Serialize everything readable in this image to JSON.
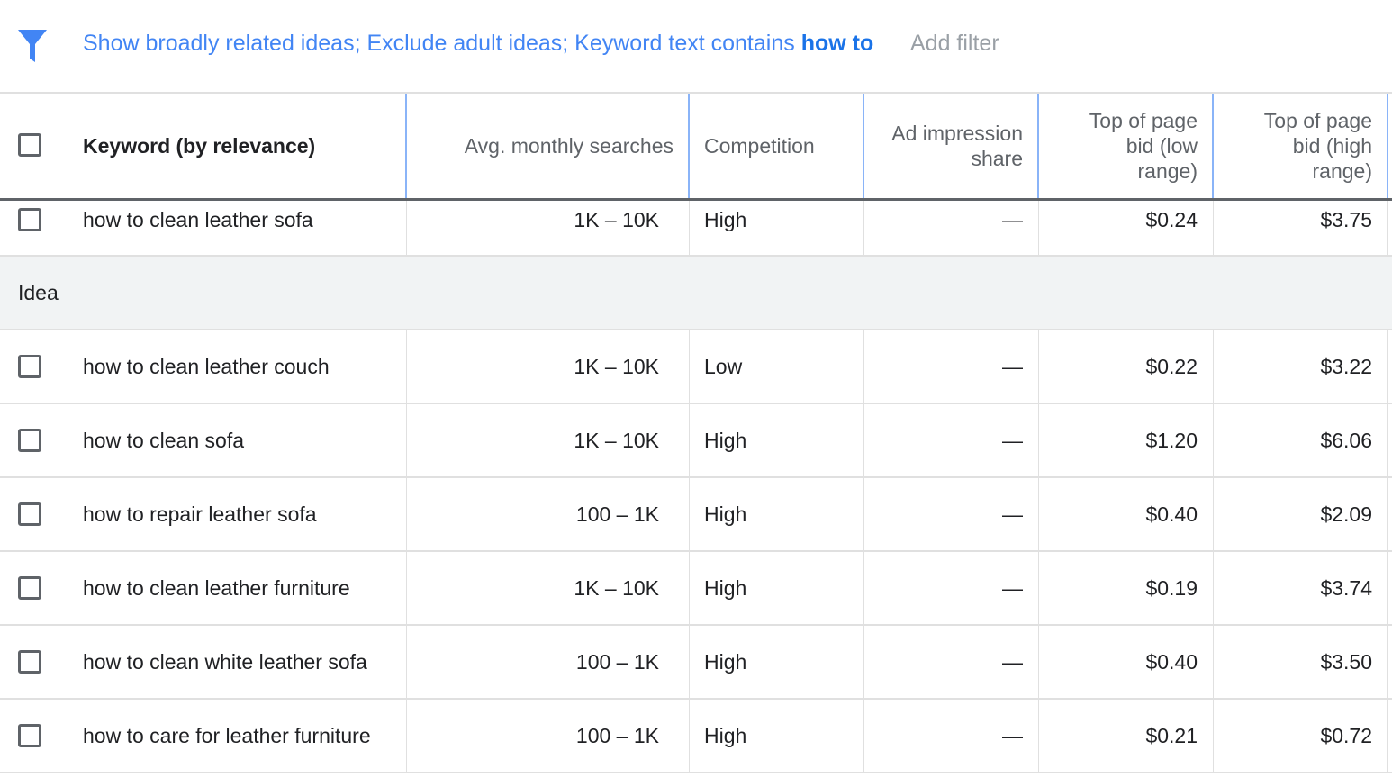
{
  "filters": {
    "text_plain": "Show broadly related ideas; Exclude adult ideas; Keyword text contains ",
    "text_bold": "how to",
    "add_filter_label": "Add filter",
    "accent_color": "#4285f4"
  },
  "table": {
    "headers": {
      "keyword": "Keyword (by relevance)",
      "searches": "Avg. monthly searches",
      "competition": "Competition",
      "impression_line1": "Ad impression",
      "impression_line2": "share",
      "bid_low_line1": "Top of page",
      "bid_low_line2": "bid (low",
      "bid_low_line3": "range)",
      "bid_high_line1": "Top of page",
      "bid_high_line2": "bid (high",
      "bid_high_line3": "range)"
    },
    "provided_row": {
      "keyword": "how to clean leather sofa",
      "searches": "1K – 10K",
      "competition": "High",
      "impression": "—",
      "bid_low": "$0.24",
      "bid_high": "$3.75"
    },
    "group_label": "Idea",
    "rows": [
      {
        "keyword": "how to clean leather couch",
        "searches": "1K – 10K",
        "competition": "Low",
        "impression": "—",
        "bid_low": "$0.22",
        "bid_high": "$3.22"
      },
      {
        "keyword": "how to clean sofa",
        "searches": "1K – 10K",
        "competition": "High",
        "impression": "—",
        "bid_low": "$1.20",
        "bid_high": "$6.06"
      },
      {
        "keyword": "how to repair leather sofa",
        "searches": "100 – 1K",
        "competition": "High",
        "impression": "—",
        "bid_low": "$0.40",
        "bid_high": "$2.09"
      },
      {
        "keyword": "how to clean leather furniture",
        "searches": "1K – 10K",
        "competition": "High",
        "impression": "—",
        "bid_low": "$0.19",
        "bid_high": "$3.74"
      },
      {
        "keyword": "how to clean white leather sofa",
        "searches": "100 – 1K",
        "competition": "High",
        "impression": "—",
        "bid_low": "$0.40",
        "bid_high": "$3.50"
      },
      {
        "keyword": "how to care for leather furniture",
        "searches": "100 – 1K",
        "competition": "High",
        "impression": "—",
        "bid_low": "$0.21",
        "bid_high": "$0.72"
      }
    ]
  }
}
